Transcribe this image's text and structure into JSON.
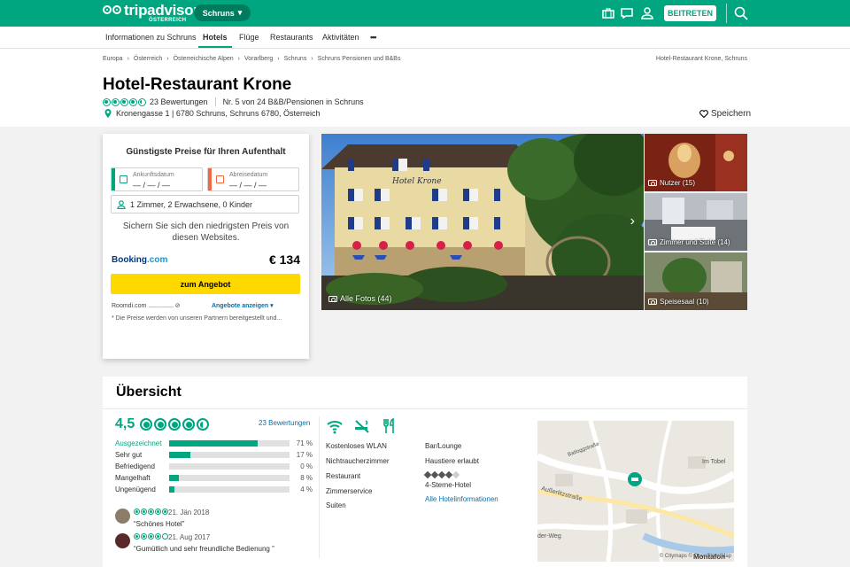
{
  "header": {
    "logo_text": "tripadvisor",
    "logo_sub": "ÖSTERREICH",
    "location_button": "Schruns",
    "join_button": "BEITRETEN",
    "icons": [
      "briefcase-icon",
      "message-icon",
      "user-icon",
      "search-icon"
    ]
  },
  "nav": {
    "items": [
      "Informationen zu Schruns",
      "Hotels",
      "Flüge",
      "Restaurants",
      "Aktivitäten",
      "•••"
    ],
    "active": "Hotels"
  },
  "breadcrumb": {
    "items": [
      "Europa",
      "Österreich",
      "Österreichische Alpen",
      "Vorarlberg",
      "Schruns",
      "Schruns Pensionen und B&Bs"
    ],
    "right": "Hotel-Restaurant Krone, Schruns"
  },
  "hotel": {
    "name": "Hotel-Restaurant Krone",
    "bubble_rating": 4.5,
    "reviews": "23 Bewertungen",
    "rank": "Nr. 5 von 24 B&B/Pensionen in Schruns",
    "address": "Kronengasse 1 | 6780 Schruns, Schruns 6780, Österreich",
    "save_label": "Speichern"
  },
  "pricebox": {
    "title": "Günstigste Preise für Ihren Aufenthalt",
    "checkin_label": "Ankunftsdatum",
    "checkin_value": "— / — / —",
    "checkout_label": "Abreisedatum",
    "checkout_value": "— / — / —",
    "guests": "1 Zimmer, 2 Erwachsene, 0 Kinder",
    "lowest_text": "Sichern Sie sich den niedrigsten Preis von diesen Websites.",
    "provider_a": "Booking",
    "provider_b": ".com",
    "price": "€ 134",
    "deal_button": "zum Angebot",
    "other_provider": "Roomdi.com",
    "other_dots": "..............................",
    "show_offers": "Angebote anzeigen ▾",
    "disclaimer": "* Die Preise werden von unseren Partnern bereitgestellt und..."
  },
  "photos": {
    "main_label": "Alle Fotos (44)",
    "thumb1": "Nutzer (15)",
    "thumb2": "Zimmer und Suite (14)",
    "thumb3": "Speisesaal (10)",
    "building_sign": "Hotel Krone"
  },
  "overview": {
    "title": "Übersicht",
    "score": "4,5",
    "reviews_link": "23 Bewertungen",
    "breakdown": [
      {
        "label": "Ausgezeichnet",
        "pct": "71 %",
        "value": 71
      },
      {
        "label": "Sehr gut",
        "pct": "17 %",
        "value": 17
      },
      {
        "label": "Befriedigend",
        "pct": "0 %",
        "value": 0
      },
      {
        "label": "Mangelhaft",
        "pct": "8 %",
        "value": 8
      },
      {
        "label": "Ungenügend",
        "pct": "4 %",
        "value": 4
      }
    ],
    "reviews": [
      {
        "date": "21. Jän 2018",
        "quote": "“Schönes Hotel”",
        "bubbles": 5
      },
      {
        "date": "21. Aug 2017",
        "quote": "“Gumütlich und sehr freundliche Bedienung ”",
        "bubbles": 4
      }
    ],
    "amenities_left": [
      "Kostenloses WLAN",
      "Nichtraucherzimmer",
      "Restaurant",
      "Zimmerservice",
      "Suiten"
    ],
    "amenities_right": [
      "Bar/Lounge",
      "Haustiere erlaubt"
    ],
    "hotel_class": "4-Sterne-Hotel",
    "hotel_class_stars": 4,
    "all_info": "Alle Hotelinformationen",
    "map_credit": "© Citymaps © OpenStreetMap",
    "map_streets": [
      "Batloggstraße",
      "Außerlitzstraße",
      "Im Tobel",
      "der-Weg",
      "Montafon"
    ]
  },
  "colors": {
    "brand": "#00a680",
    "deal": "#ffd800",
    "link": "#0a6ea6"
  }
}
